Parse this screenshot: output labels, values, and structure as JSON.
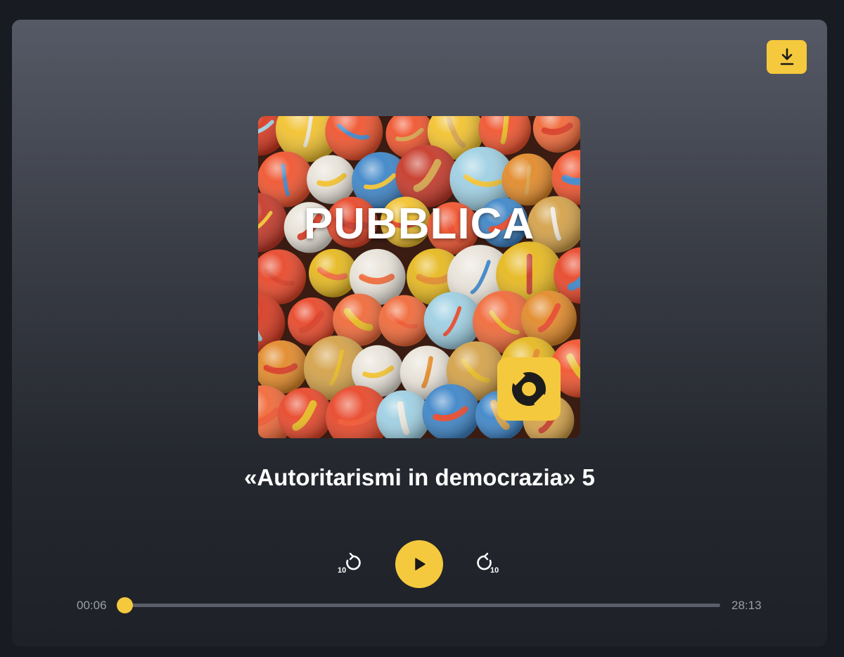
{
  "cover": {
    "title": "PUBBLICA",
    "image_description": "colorful-marbles-artwork"
  },
  "episode": {
    "title": "«Autoritarismi in democrazia» 5"
  },
  "controls": {
    "rewind_seconds": "10",
    "forward_seconds": "10"
  },
  "progress": {
    "current_time": "00:06",
    "total_time": "28:13",
    "fraction": 0.0035
  },
  "icons": {
    "download": "download-icon",
    "play": "play-icon",
    "rewind": "rewind-10-icon",
    "forward": "forward-10-icon"
  },
  "colors": {
    "accent": "#f5c93d",
    "track": "#5a5e68",
    "text": "#ffffff",
    "muted_text": "#9a9ea8"
  }
}
